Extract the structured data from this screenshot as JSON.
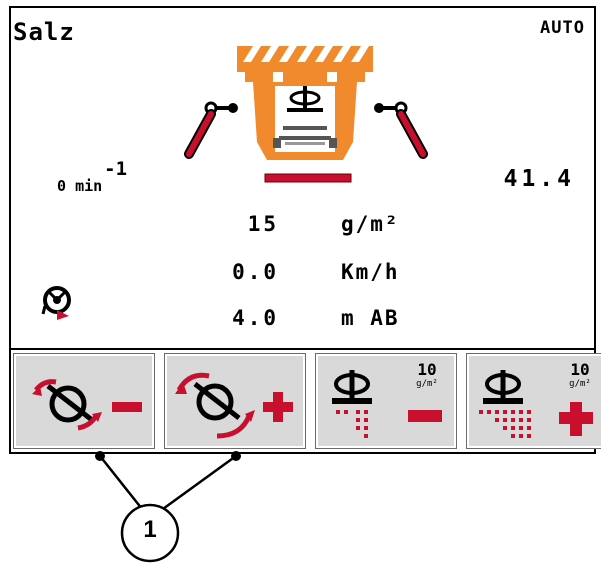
{
  "header": {
    "product": "Salz",
    "mode": "AUTO"
  },
  "readouts": {
    "disc_speed_value": "0",
    "disc_speed_unit": "min",
    "disc_speed_exponent": "-1",
    "right_value": "41.4"
  },
  "rows": [
    {
      "value": "15",
      "unit": "g/m²"
    },
    {
      "value": "0.0",
      "unit": "Km/h"
    },
    {
      "value": "4.0",
      "unit": "m AB"
    }
  ],
  "softkeys": [
    {
      "name": "spread-width-decrease",
      "icon": "spread-pattern-minus-icon"
    },
    {
      "name": "spread-width-increase",
      "icon": "spread-pattern-plus-icon"
    },
    {
      "name": "rate-decrease",
      "icon": "spreader-disc-rate-minus-icon",
      "step": "10",
      "step_unit": "g/m²"
    },
    {
      "name": "rate-increase",
      "icon": "spreader-disc-rate-plus-icon",
      "step": "10",
      "step_unit": "g/m²"
    }
  ],
  "callout": {
    "number": "1"
  },
  "colors": {
    "orange": "#f08a2c",
    "red": "#c8102e",
    "button": "#d9d9d9"
  }
}
